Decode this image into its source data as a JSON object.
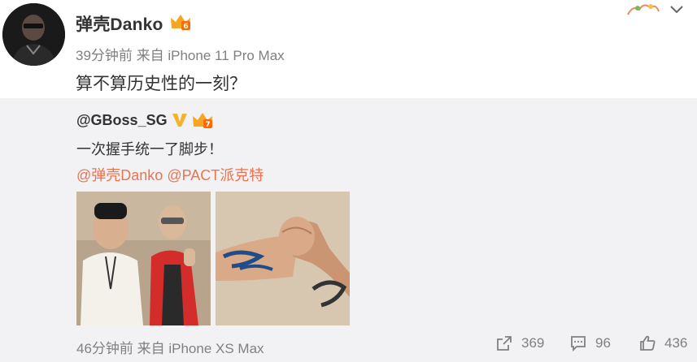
{
  "post": {
    "username": "弹壳Danko",
    "meta": "39分钟前 来自 iPhone 11 Pro Max",
    "text": "算不算历史性的一刻？"
  },
  "repost": {
    "username": "@GBoss_SG",
    "text": "一次握手统一了脚步！",
    "mentions": [
      "@弹壳Danko",
      "@PACT派克特"
    ],
    "meta": "46分钟前 来自 iPhone XS Max",
    "actions": {
      "share_count": "369",
      "comment_count": "96",
      "like_count": "436"
    }
  },
  "colors": {
    "mention": "#eb7350",
    "repost_bg": "#f2f2f5",
    "meta": "#808080",
    "vip": "#f5a623"
  },
  "icons": [
    "vip-crown-icon",
    "verified-v-icon",
    "chevron-down-icon",
    "share-icon",
    "comment-icon",
    "like-icon"
  ]
}
